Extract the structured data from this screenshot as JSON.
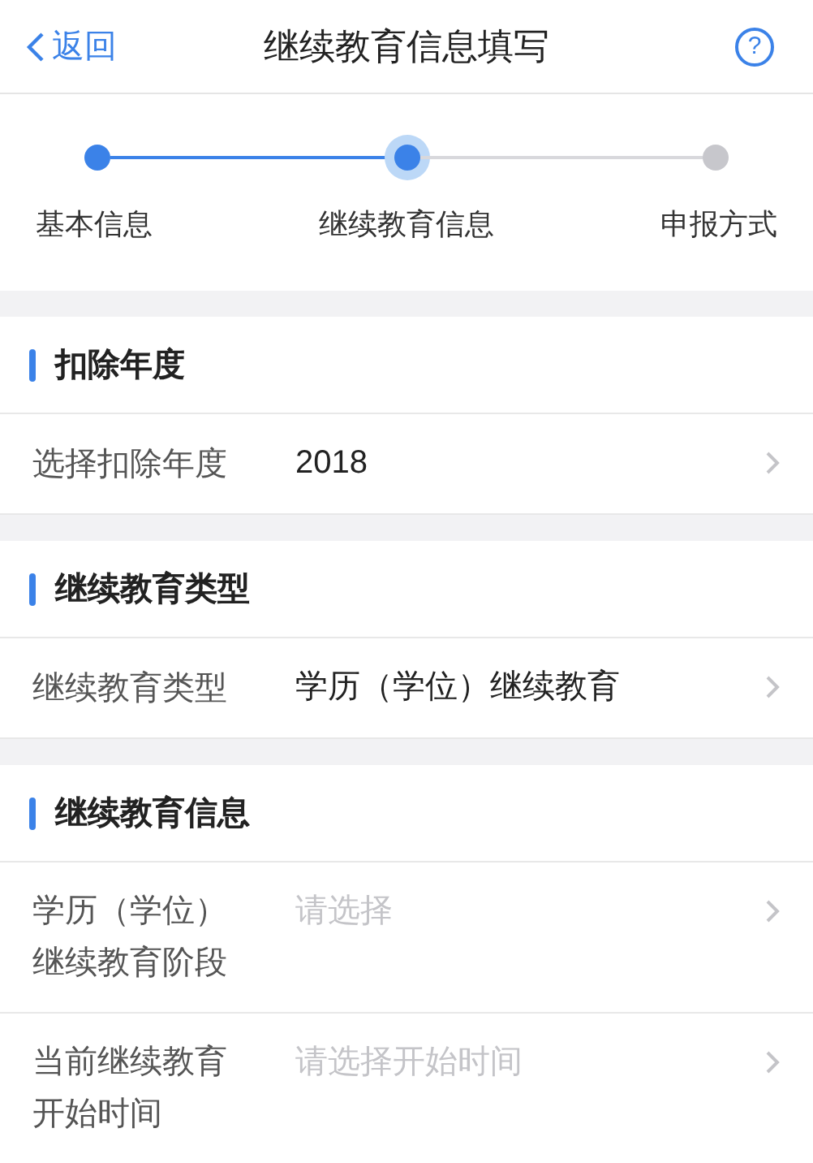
{
  "header": {
    "back": "返回",
    "title": "继续教育信息填写",
    "help": "?"
  },
  "steps": [
    {
      "label": "基本信息",
      "kind": "done"
    },
    {
      "label": "继续教育信息",
      "kind": "current"
    },
    {
      "label": "申报方式",
      "kind": "todo"
    }
  ],
  "sections": [
    {
      "title": "扣除年度",
      "rows": [
        {
          "label": "选择扣除年度",
          "value": "2018"
        }
      ]
    },
    {
      "title": "继续教育类型",
      "rows": [
        {
          "label": "继续教育类型",
          "value": "学历（学位）继续教育"
        }
      ]
    },
    {
      "title": "继续教育信息",
      "rows": [
        {
          "label": "学历（学位）继续教育阶段",
          "placeholder": "请选择"
        },
        {
          "label": "当前继续教育开始时间",
          "placeholder": "请选择开始时间"
        }
      ]
    }
  ]
}
